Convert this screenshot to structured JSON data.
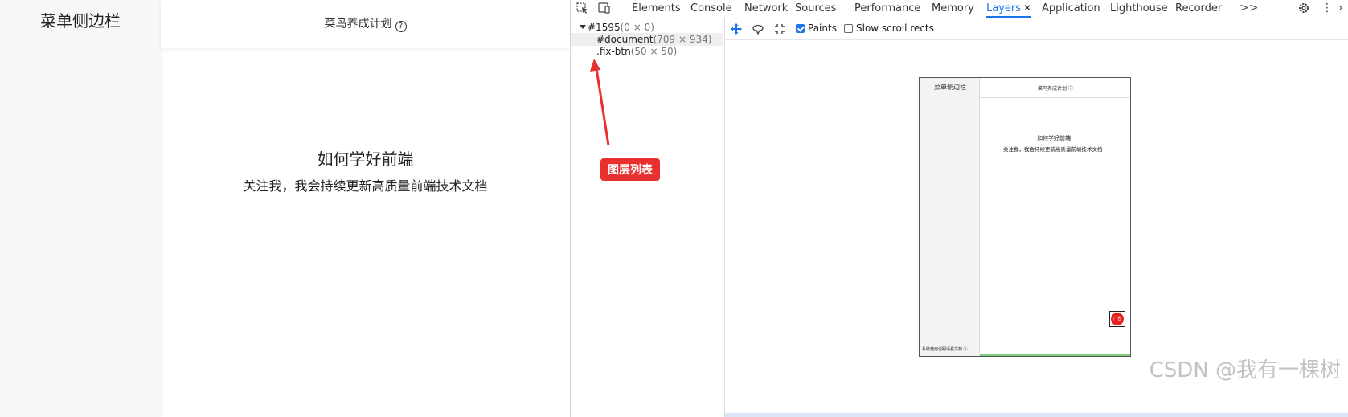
{
  "page": {
    "sidebar_title": "菜单侧边栏",
    "header_title": "菜鸟养成计划",
    "header_icon": "question-circle-icon",
    "content_title": "如何学好前端",
    "content_subtitle": "关注我，我会持续更新高质量前端技术文档"
  },
  "devtools": {
    "tabs": [
      {
        "label": "Elements"
      },
      {
        "label": "Console"
      },
      {
        "label": "Network"
      },
      {
        "label": "Sources"
      },
      {
        "label": "Performance"
      },
      {
        "label": "Memory"
      },
      {
        "label": "Layers",
        "active": true
      },
      {
        "label": "Application"
      },
      {
        "label": "Lighthouse"
      },
      {
        "label": "Recorder"
      }
    ],
    "more_tabs": ">>",
    "layers_tree": {
      "root": {
        "name": "#1595",
        "dims": "(0 × 0)"
      },
      "children": [
        {
          "name": "#document",
          "dims": "(709 × 934)"
        },
        {
          "name": ".fix-btn",
          "dims": "(50 × 50)"
        }
      ]
    },
    "toolbar": {
      "paints_label": "Paints",
      "paints_checked": true,
      "slow_scroll_label": "Slow scroll rects",
      "slow_scroll_checked": false
    },
    "annotation_label": "图层列表",
    "preview": {
      "sidebar_title": "菜单侧边栏",
      "header_title": "菜鸟养成计划 ⓘ",
      "content_title": "如何学好前端",
      "content_subtitle": "关注我，我会持续更新高质量前端技术文档",
      "footer_text": "系统使用说明请看文档 ⓘ",
      "fix_btn_text": "广告"
    }
  },
  "watermark": "CSDN @我有一棵树",
  "colors": {
    "accent": "#1a73e8",
    "annotation": "#e8312f",
    "fix_btn": "#e8201f"
  }
}
